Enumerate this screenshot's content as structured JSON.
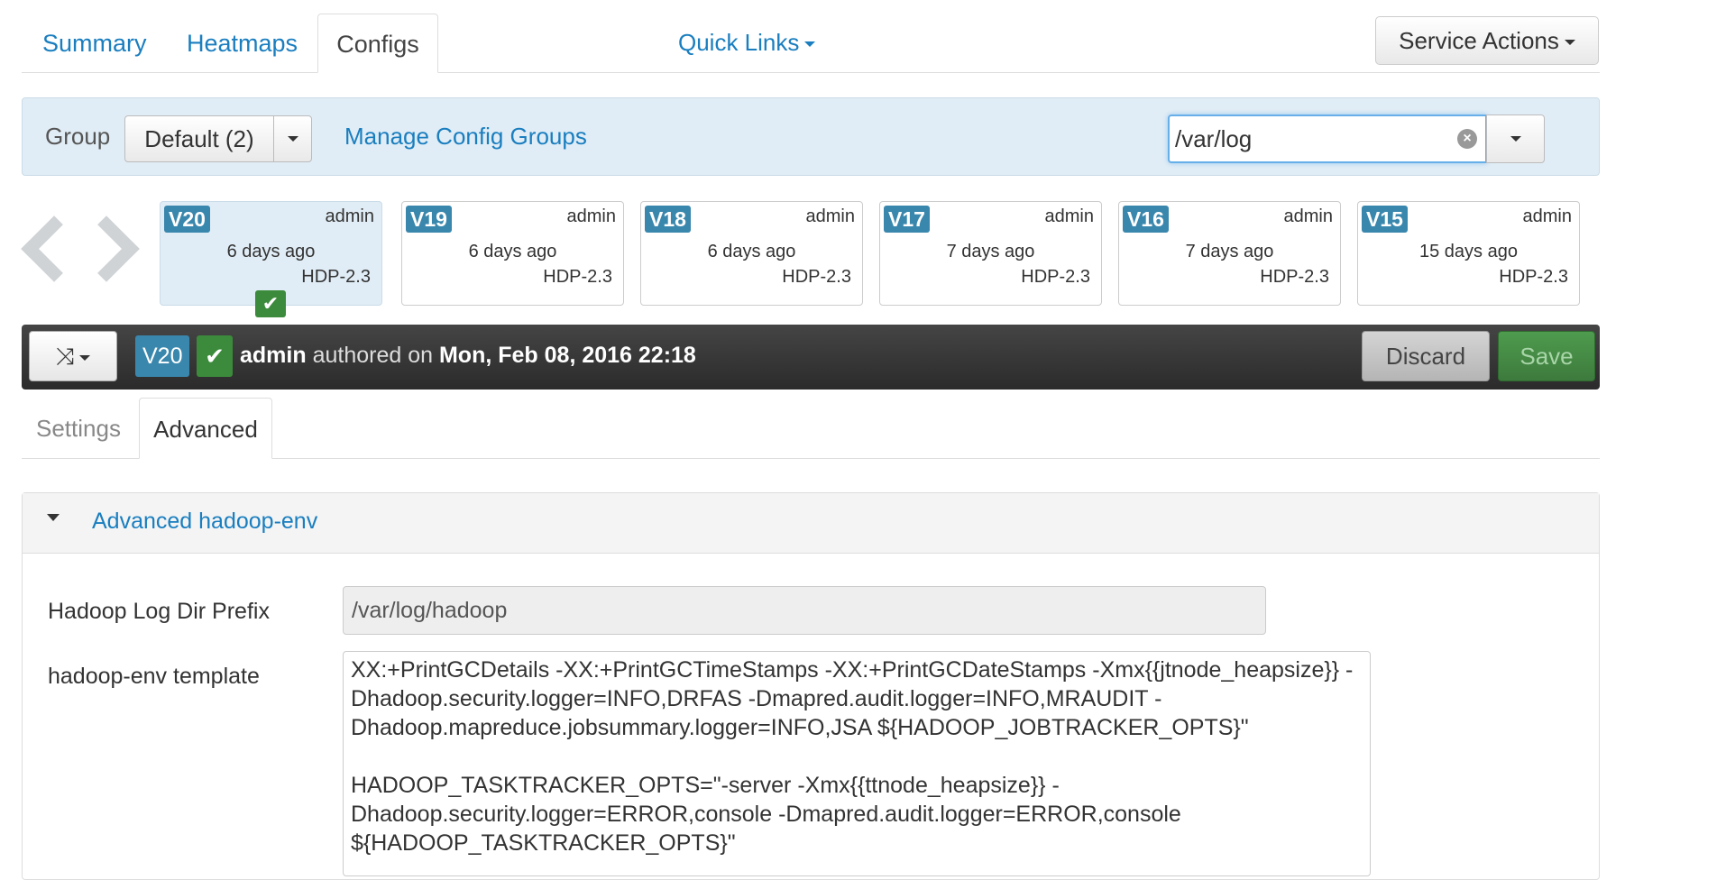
{
  "nav": {
    "tabs": [
      {
        "label": "Summary"
      },
      {
        "label": "Heatmaps"
      },
      {
        "label": "Configs"
      }
    ],
    "quick_links": "Quick Links",
    "service_actions": "Service Actions"
  },
  "group_bar": {
    "label": "Group",
    "selected": "Default (2)",
    "manage_link": "Manage Config Groups",
    "filter_value": "/var/log"
  },
  "versions": [
    {
      "badge": "V20",
      "author": "admin",
      "time": "6 days ago",
      "stack": "HDP-2.3",
      "current": true
    },
    {
      "badge": "V19",
      "author": "admin",
      "time": "6 days ago",
      "stack": "HDP-2.3"
    },
    {
      "badge": "V18",
      "author": "admin",
      "time": "6 days ago",
      "stack": "HDP-2.3"
    },
    {
      "badge": "V17",
      "author": "admin",
      "time": "7 days ago",
      "stack": "HDP-2.3"
    },
    {
      "badge": "V16",
      "author": "admin",
      "time": "7 days ago",
      "stack": "HDP-2.3"
    },
    {
      "badge": "V15",
      "author": "admin",
      "time": "15 days ago",
      "stack": "HDP-2.3"
    }
  ],
  "current_version": {
    "badge": "V20",
    "author": "admin",
    "authored_text": "authored on",
    "date": "Mon, Feb 08, 2016 22:18",
    "discard": "Discard",
    "save": "Save"
  },
  "sub_tabs": [
    {
      "label": "Settings"
    },
    {
      "label": "Advanced"
    }
  ],
  "panel": {
    "title": "Advanced hadoop-env",
    "fields": {
      "log_dir_label": "Hadoop Log Dir Prefix",
      "log_dir_value": "/var/log/hadoop",
      "template_label": "hadoop-env template",
      "template_value": "XX:+PrintGCDetails -XX:+PrintGCTimeStamps -XX:+PrintGCDateStamps -Xmx{{jtnode_heapsize}} -Dhadoop.security.logger=INFO,DRFAS -Dmapred.audit.logger=INFO,MRAUDIT -Dhadoop.mapreduce.jobsummary.logger=INFO,JSA ${HADOOP_JOBTRACKER_OPTS}\"\n\nHADOOP_TASKTRACKER_OPTS=\"-server -Xmx{{ttnode_heapsize}} -Dhadoop.security.logger=ERROR,console -Dmapred.audit.logger=ERROR,console ${HADOOP_TASKTRACKER_OPTS}\""
    }
  },
  "icons": {
    "shuffle": "shuffle-icon",
    "check": "check-icon",
    "clear": "clear-icon"
  }
}
